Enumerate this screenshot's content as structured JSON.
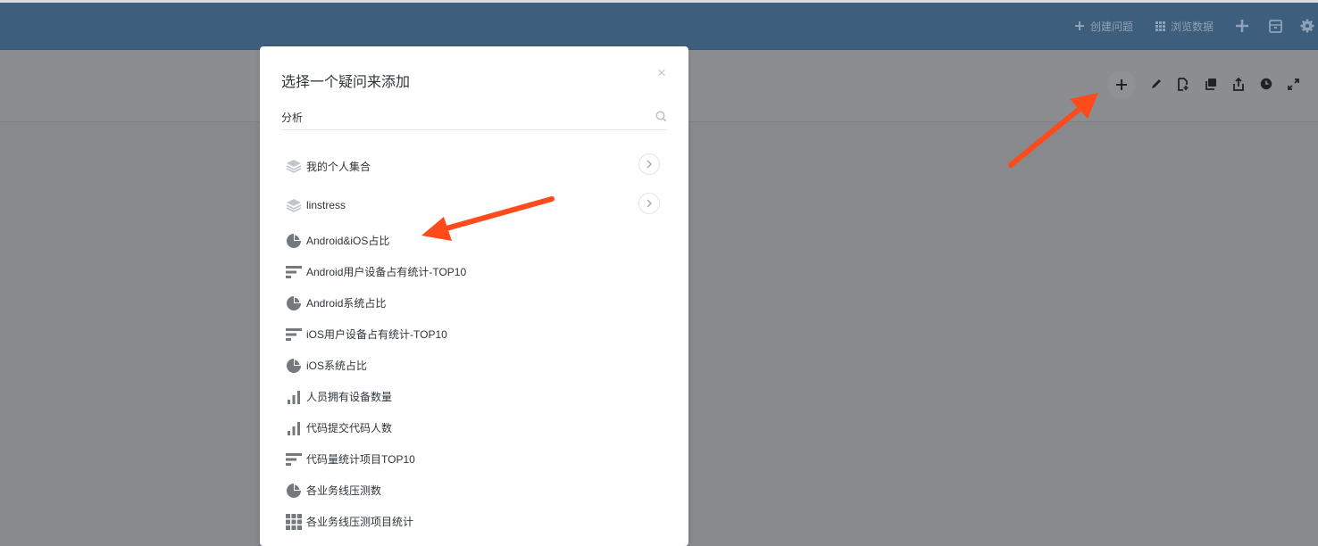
{
  "navbar": {
    "create_question_label": "创建问题",
    "browse_data_label": "浏览数据"
  },
  "modal": {
    "title": "选择一个疑问来添加",
    "close_glyph": "×",
    "search": {
      "value": "分析",
      "placeholder": ""
    },
    "collections": [
      {
        "label": "我的个人集合",
        "icon": "collection-icon"
      },
      {
        "label": "linstress",
        "icon": "collection-icon"
      }
    ],
    "questions": [
      {
        "label": "Android&iOS占比",
        "icon": "pie-chart-icon"
      },
      {
        "label": "Android用户设备占有统计-TOP10",
        "icon": "row-chart-icon"
      },
      {
        "label": "Android系统占比",
        "icon": "pie-chart-icon"
      },
      {
        "label": "iOS用户设备占有统计-TOP10",
        "icon": "row-chart-icon"
      },
      {
        "label": "iOS系统占比",
        "icon": "pie-chart-icon"
      },
      {
        "label": "人员拥有设备数量",
        "icon": "bar-chart-icon"
      },
      {
        "label": "代码提交代码人数",
        "icon": "bar-chart-icon"
      },
      {
        "label": "代码量统计项目TOP10",
        "icon": "row-chart-icon"
      },
      {
        "label": "各业务线压测数",
        "icon": "pie-chart-icon"
      },
      {
        "label": "各业务线压测项目统计",
        "icon": "table-icon"
      }
    ]
  },
  "colors": {
    "navbar": "#3e5e7d",
    "overlay": "#87898c",
    "annotation_arrow": "#ff4a1c",
    "icon_gray": "#74797e"
  }
}
